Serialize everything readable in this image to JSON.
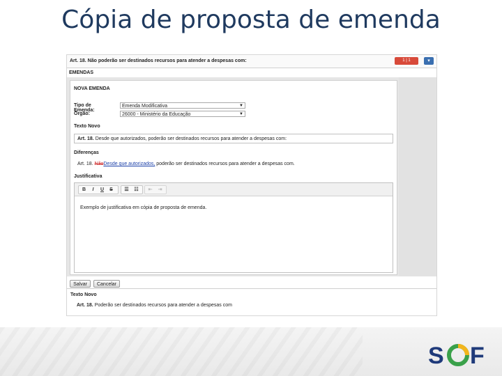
{
  "slide": {
    "title": "Cópia de proposta de emenda",
    "logo_letters": "SOF"
  },
  "app": {
    "header_article": "Art. 18. Não poderão ser destinados recursos para atender a despesas com:",
    "header_badge": "1 | 1",
    "section_title": "EMENDAS",
    "nova_emenda_title": "NOVA EMENDA",
    "tipo_label": "Tipo de Emenda:",
    "tipo_value": "Emenda Modificativa",
    "orgao_label": "Órgão:",
    "orgao_value": "26000 - Ministério da Educação",
    "texto_novo_label": "Texto Novo",
    "texto_novo_prefix": "Art. 18.",
    "texto_novo_value": "Desde que autorizados, poderão ser destinados recursos para atender a despesas com:",
    "diferencas_label": "Diferenças",
    "diff_prefix": "Art. 18.",
    "diff_deleted": "Não",
    "diff_inserted": "Desde que autorizados,",
    "diff_rest": "poderão ser destinados recursos para atender a despesas com.",
    "justificativa_label": "Justificativa",
    "toolbar": {
      "bold": "B",
      "italic": "I",
      "underline": "U",
      "strike": "S"
    },
    "justificativa_text": "Exemplo de justificativa em cópia de proposta de emenda.",
    "save_label": "Salvar",
    "cancel_label": "Cancelar",
    "bottom_texto_novo_label": "Texto Novo",
    "bottom_prefix": "Art. 18.",
    "bottom_text": "Poderão ser destinados recursos para atender a despesas com"
  },
  "colors": {
    "title": "#1f3a5f",
    "badge": "#d84a3a",
    "dropdown": "#3a6fb0",
    "deleted": "#cc2222",
    "inserted": "#1a3fa8",
    "logo_blue": "#1f3a7a",
    "logo_green": "#3aa14a",
    "logo_yellow": "#f2b51c"
  }
}
